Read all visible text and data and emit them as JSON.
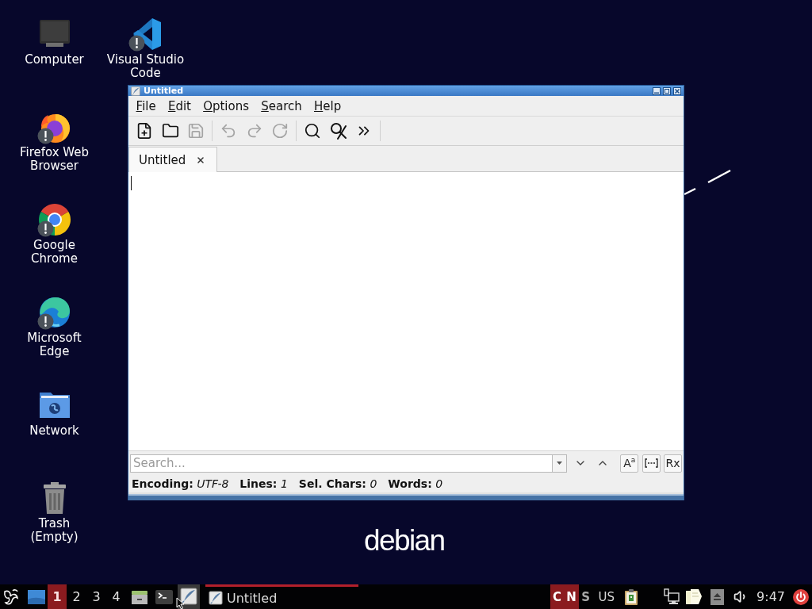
{
  "desktop": {
    "icons": [
      {
        "kind": "computer",
        "label": "Computer",
        "warning": false
      },
      {
        "kind": "firefox",
        "label": "Firefox Web Browser",
        "warning": true
      },
      {
        "kind": "chrome",
        "label": "Google Chrome",
        "warning": true
      },
      {
        "kind": "edge",
        "label": "Microsoft Edge",
        "warning": true
      },
      {
        "kind": "network",
        "label": "Network",
        "warning": false
      },
      {
        "kind": "trash",
        "label": "Trash (Empty)",
        "warning": false
      },
      {
        "kind": "vscode",
        "label": "Visual Studio Code",
        "warning": true
      }
    ],
    "logo": "debian"
  },
  "window": {
    "title": "Untitled",
    "menu": [
      "File",
      "Edit",
      "Options",
      "Search",
      "Help"
    ],
    "toolbar": [
      {
        "items": [
          {
            "kind": "new",
            "disabled": false
          },
          {
            "kind": "open",
            "disabled": false
          },
          {
            "kind": "save",
            "disabled": true
          }
        ]
      },
      {
        "items": [
          {
            "kind": "undo",
            "disabled": true
          },
          {
            "kind": "redo",
            "disabled": true
          },
          {
            "kind": "reload",
            "disabled": true
          }
        ]
      },
      {
        "items": [
          {
            "kind": "find",
            "disabled": false
          },
          {
            "kind": "replace",
            "disabled": false
          },
          {
            "kind": "more",
            "disabled": false
          }
        ]
      }
    ],
    "tabs": [
      {
        "label": "Untitled",
        "selected": true
      }
    ],
    "search": {
      "placeholder": "Search...",
      "options": [
        {
          "kind": "match-case",
          "label": "A$^{a}$"
        },
        {
          "kind": "whole-word"
        },
        {
          "kind": "regex",
          "label": "Rx"
        }
      ]
    },
    "status": [
      {
        "label": "Encoding:",
        "value": "UTF-8"
      },
      {
        "label": "Lines:",
        "value": "1"
      },
      {
        "label": "Sel. Chars:",
        "value": "0"
      },
      {
        "label": "Words:",
        "value": "0"
      }
    ]
  },
  "taskbar": {
    "workspaces": [
      {
        "label": "1",
        "selected": true
      },
      {
        "label": "2",
        "selected": false
      },
      {
        "label": "3",
        "selected": false
      },
      {
        "label": "4",
        "selected": false
      }
    ],
    "launchers": [
      {
        "kind": "files",
        "hovered": false
      },
      {
        "kind": "terminal",
        "hovered": false
      },
      {
        "kind": "editor",
        "hovered": true
      }
    ],
    "tasks": [
      {
        "title": "Untitled",
        "selected": true
      }
    ],
    "locks": [
      {
        "label": "C",
        "on": true
      },
      {
        "label": "N",
        "on": true
      },
      {
        "label": "S",
        "on": false
      }
    ],
    "keyboard_layout": "US",
    "tray": [
      {
        "kind": "clipboard"
      },
      {
        "kind": "network"
      },
      {
        "kind": "notes"
      },
      {
        "kind": "eject"
      },
      {
        "kind": "volume"
      }
    ],
    "clock": "9:47"
  }
}
